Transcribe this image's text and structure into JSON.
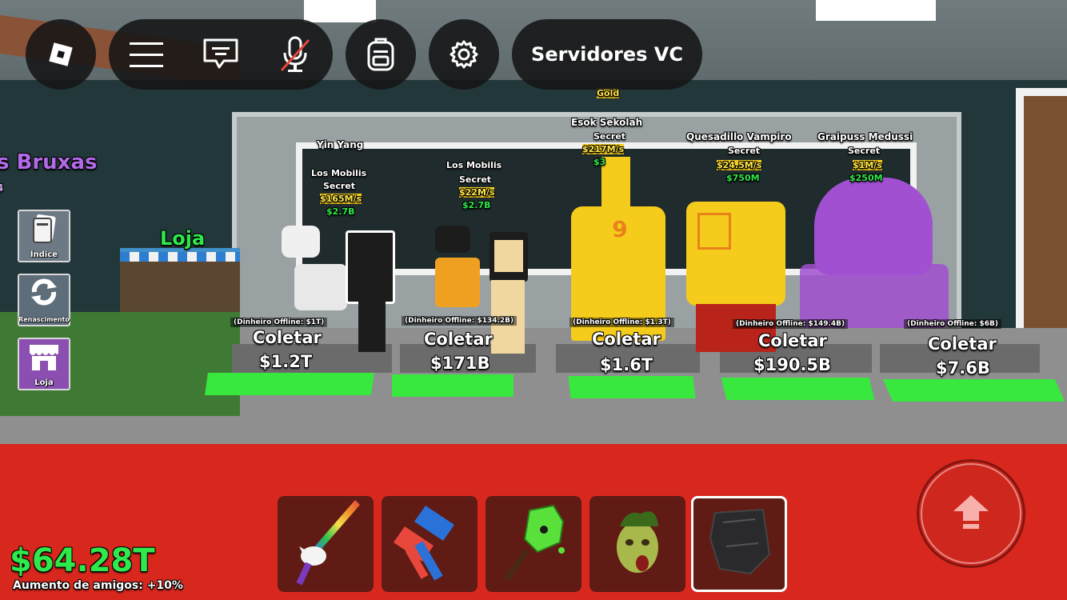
{
  "top_bar": {
    "voice_chat_label": "Servidores VC"
  },
  "icons": {
    "roblox": "roblox-logo-icon",
    "menu": "hamburger-menu-icon",
    "chat": "chat-icon",
    "mic": "microphone-muted-icon",
    "backpack": "backpack-icon",
    "settings": "gear-icon",
    "jump": "jump-arrow-icon"
  },
  "area_sign": "s Bruxas",
  "area_sign_sub": "4",
  "side_menu": [
    {
      "label": "Índice"
    },
    {
      "label": "Renascimento"
    },
    {
      "label": "Loja"
    }
  ],
  "world_shop_sign": "Loja",
  "brainrots": [
    {
      "name": "Yin Yang",
      "sub_name": "Los Mobilis",
      "rarity": "Secret",
      "rate": "$165M/s",
      "price": "$2.7B",
      "offline": "(Dinheiro Offline: $1T)",
      "action": "Coletar",
      "money": "$1.2T"
    },
    {
      "name": "Los Mobilis",
      "rarity": "Secret",
      "rate": "$22M/s",
      "price": "$2.7B",
      "offline": "(Dinheiro Offline: $134.2B)",
      "action": "Coletar",
      "money": "$171B"
    },
    {
      "name": "Esok Sekolah",
      "mutation": "Gold",
      "rarity": "Secret",
      "rate": "$217M/s",
      "price": "$3",
      "offline": "(Dinheiro Offline: $1.3T)",
      "action": "Coletar",
      "money": "$1.6T"
    },
    {
      "name": "Quesadillo Vampiro",
      "rarity": "Secret",
      "rate": "$24.5M/s",
      "price": "$750M",
      "offline": "(Dinheiro Offline: $149.4B)",
      "action": "Coletar",
      "money": "$190.5B"
    },
    {
      "name": "Graipuss Medussi",
      "rarity": "Secret",
      "rate": "$1M/s",
      "price": "$250M",
      "offline": "(Dinheiro Offline: $6B)",
      "action": "Coletar",
      "money": "$7.6B"
    }
  ],
  "hotbar": [
    {
      "item": "unicorn-sword-icon",
      "selected": false
    },
    {
      "item": "blue-red-hammer-icon",
      "selected": false
    },
    {
      "item": "green-slime-glove-icon",
      "selected": false
    },
    {
      "item": "medusa-head-icon",
      "selected": false
    },
    {
      "item": "black-cape-icon",
      "selected": true
    }
  ],
  "player": {
    "money": "$64.28T",
    "friends_boost": "Aumento de amigos: +10%"
  },
  "colors": {
    "money_green": "#2ee84c",
    "pad_green": "#38e83e",
    "floor_red": "#d8281e",
    "topbar_bg": "#141416"
  }
}
